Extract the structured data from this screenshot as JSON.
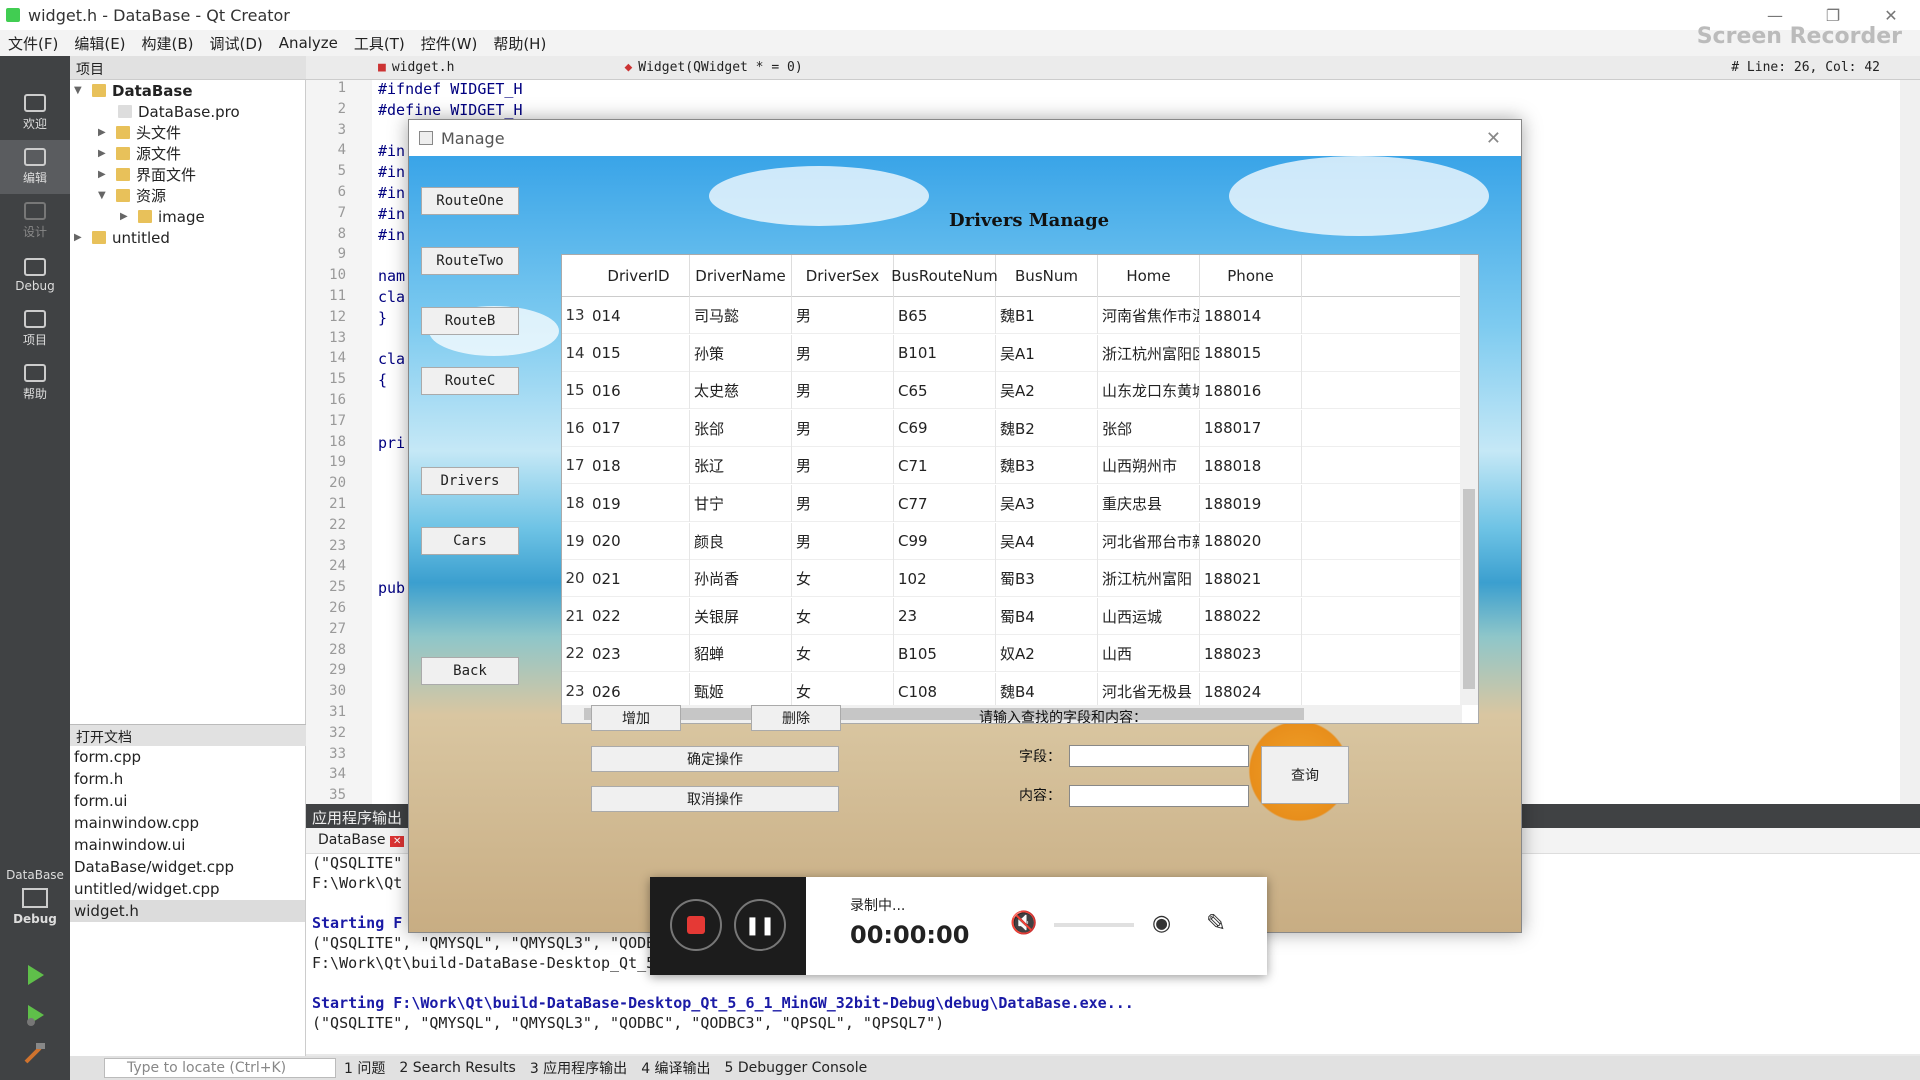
{
  "window": {
    "title": "widget.h - DataBase - Qt Creator",
    "watermark": "Screen Recorder",
    "min": "—",
    "max": "❐",
    "close": "✕"
  },
  "menu": [
    "文件(F)",
    "编辑(E)",
    "构建(B)",
    "调试(D)",
    "Analyze",
    "工具(T)",
    "控件(W)",
    "帮助(H)"
  ],
  "modes": [
    {
      "label": "欢迎",
      "icon": "grid-icon"
    },
    {
      "label": "编辑",
      "icon": "edit-icon"
    },
    {
      "label": "设计",
      "icon": "pen-icon"
    },
    {
      "label": "Debug",
      "icon": "bug-icon"
    },
    {
      "label": "项目",
      "icon": "wrench-icon"
    },
    {
      "label": "帮助",
      "icon": "help-icon"
    }
  ],
  "kit": {
    "project": "DataBase",
    "mode": "Debug"
  },
  "project_panel": {
    "title": "项目",
    "tree": [
      {
        "label": "DataBase",
        "bold": true
      },
      {
        "label": "DataBase.pro"
      },
      {
        "label": "头文件"
      },
      {
        "label": "源文件"
      },
      {
        "label": "界面文件"
      },
      {
        "label": "资源"
      },
      {
        "label": "image"
      },
      {
        "label": "untitled"
      }
    ]
  },
  "open_docs": {
    "title": "打开文档",
    "items": [
      "form.cpp",
      "form.h",
      "form.ui",
      "mainwindow.cpp",
      "mainwindow.ui",
      "DataBase/widget.cpp",
      "untitled/widget.cpp",
      "widget.h"
    ],
    "selected": 7
  },
  "editor": {
    "file": "widget.h",
    "symbol": "Widget(QWidget * = 0)",
    "position": "# Line: 26, Col: 42",
    "lines": [
      "#ifndef WIDGET_H",
      "#define WIDGET_H",
      "",
      "#in",
      "#in",
      "#in",
      "#in",
      "#in",
      "",
      "nam",
      "cla",
      "}",
      "",
      "cla",
      "{",
      "",
      "",
      "pri",
      "",
      "",
      "",
      "",
      "",
      "",
      "pub",
      "",
      "",
      "",
      "",
      "",
      "",
      "",
      "",
      "",
      "",
      "pri"
    ]
  },
  "output": {
    "header": "应用程序输出",
    "tab": "DataBase",
    "lines": [
      {
        "text": "(\"QSQLITE\"",
        "blue": false
      },
      {
        "text": "F:\\Work\\Qt",
        "blue": false
      },
      {
        "text": "",
        "blue": false
      },
      {
        "text": "Starting F",
        "blue": true
      },
      {
        "text": "(\"QSQLITE\", \"QMYSQL\", \"QMYSQL3\", \"QODBC\", \"QODBC3\", \"QPSQL\", \"QPSQL7\")",
        "blue": false
      },
      {
        "text": "F:\\Work\\Qt\\build-DataBase-Desktop_Qt_5_6_1_MinGW_32bit-Debug\\debug\\DataBase.exe exited with code 0",
        "blue": false
      },
      {
        "text": "",
        "blue": false
      },
      {
        "text": "Starting F:\\Work\\Qt\\build-DataBase-Desktop_Qt_5_6_1_MinGW_32bit-Debug\\debug\\DataBase.exe...",
        "blue": true
      },
      {
        "text": "(\"QSQLITE\", \"QMYSQL\", \"QMYSQL3\", \"QODBC\", \"QODBC3\", \"QPSQL\", \"QPSQL7\")",
        "blue": false
      }
    ]
  },
  "statusbar": {
    "locator": "Type to locate (Ctrl+K)",
    "tabs": [
      "1 问题",
      "2 Search Results",
      "3 应用程序输出",
      "4 编译输出",
      "5 Debugger Console"
    ]
  },
  "dialog": {
    "title": "Manage",
    "heading": "Drivers Manage",
    "side_buttons": [
      "RouteOne",
      "RouteTwo",
      "RouteB",
      "RouteC",
      "Drivers",
      "Cars",
      "Back"
    ],
    "columns": [
      "DriverID",
      "DriverName",
      "DriverSex",
      "BusRouteNum",
      "BusNum",
      "Home",
      "Phone"
    ],
    "rows": [
      {
        "n": "13",
        "c": [
          "014",
          "司马懿",
          "男",
          "B65",
          "魏B1",
          "河南省焦作市温...",
          "188014"
        ]
      },
      {
        "n": "14",
        "c": [
          "015",
          "孙策",
          "男",
          "B101",
          "吴A1",
          "浙江杭州富阳区",
          "188015"
        ]
      },
      {
        "n": "15",
        "c": [
          "016",
          "太史慈",
          "男",
          "C65",
          "吴A2",
          "山东龙口东黄城...",
          "188016"
        ]
      },
      {
        "n": "16",
        "c": [
          "017",
          "张郃",
          "男",
          "C69",
          "魏B2",
          "张郃",
          "188017"
        ]
      },
      {
        "n": "17",
        "c": [
          "018",
          "张辽",
          "男",
          "C71",
          "魏B3",
          "山西朔州市",
          "188018"
        ]
      },
      {
        "n": "18",
        "c": [
          "019",
          "甘宁",
          "男",
          "C77",
          "吴A3",
          "重庆忠县",
          "188019"
        ]
      },
      {
        "n": "19",
        "c": [
          "020",
          "颜良",
          "男",
          "C99",
          "吴A4",
          "河北省邢台市新...",
          "188020"
        ]
      },
      {
        "n": "20",
        "c": [
          "021",
          "孙尚香",
          "女",
          "102",
          "蜀B3",
          "浙江杭州富阳",
          "188021"
        ]
      },
      {
        "n": "21",
        "c": [
          "022",
          "关银屏",
          "女",
          "23",
          "蜀B4",
          "山西运城",
          "188022"
        ]
      },
      {
        "n": "22",
        "c": [
          "023",
          "貂蝉",
          "女",
          "B105",
          "奴A2",
          "山西",
          "188023"
        ]
      },
      {
        "n": "23",
        "c": [
          "026",
          "甄姬",
          "女",
          "C108",
          "魏B4",
          "河北省无极县",
          "188024"
        ]
      }
    ],
    "add": "增加",
    "delete": "删除",
    "confirm": "确定操作",
    "cancel": "取消操作",
    "search_prompt": "请输入查找的字段和内容：",
    "field_label": "字段：",
    "content_label": "内容：",
    "query": "查询",
    "field_value": "",
    "content_value": ""
  },
  "recorder": {
    "status": "录制中...",
    "time": "00:00:00"
  }
}
